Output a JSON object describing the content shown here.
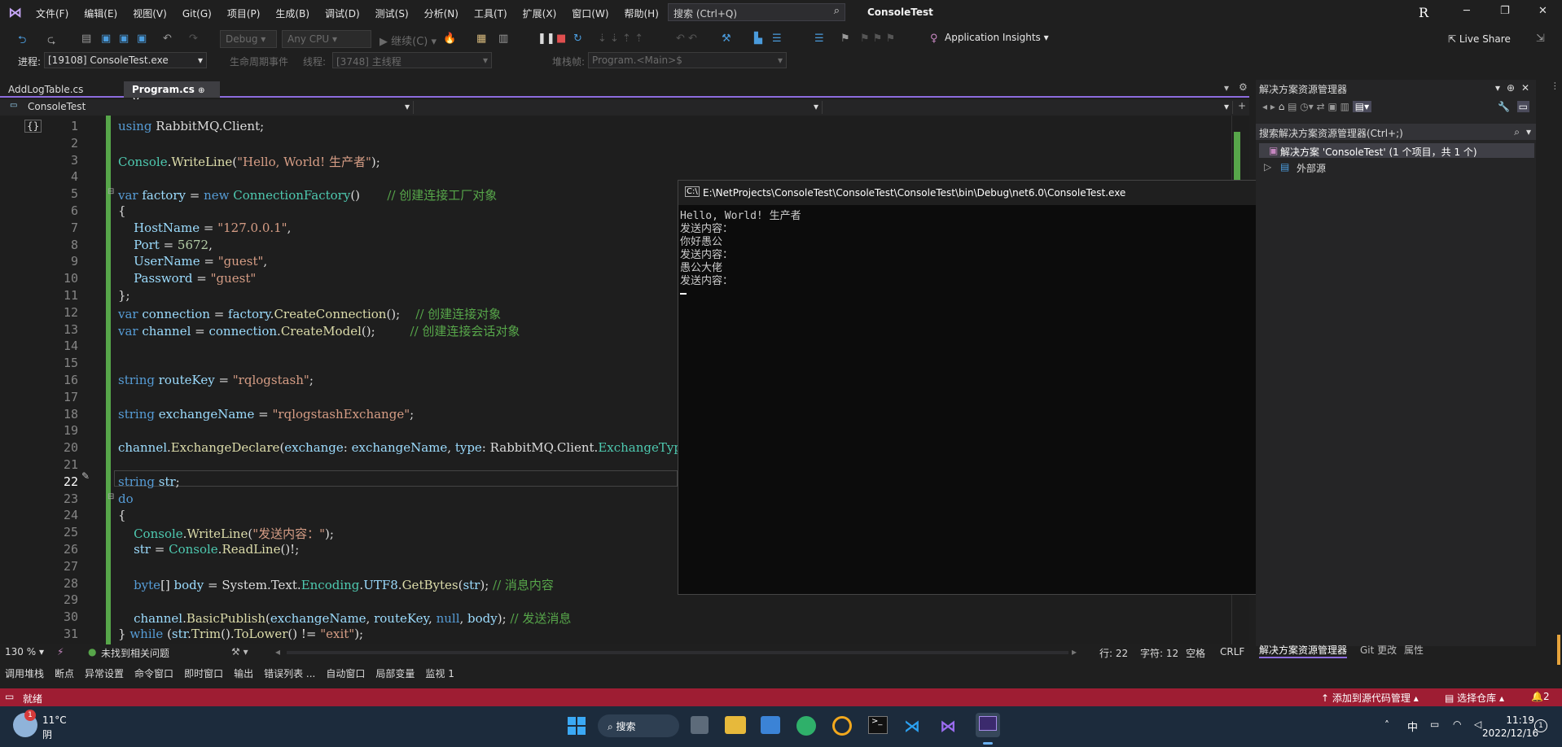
{
  "menubar": {
    "items": [
      "文件(F)",
      "编辑(E)",
      "视图(V)",
      "Git(G)",
      "项目(P)",
      "生成(B)",
      "调试(D)",
      "测试(S)",
      "分析(N)",
      "工具(T)",
      "扩展(X)",
      "窗口(W)",
      "帮助(H)"
    ],
    "search_placeholder": "搜索 (Ctrl+Q)",
    "app_name": "ConsoleTest",
    "avatar": "R"
  },
  "toolbar": {
    "config": "Debug",
    "platform": "Any CPU",
    "continue": "继续(C)",
    "app_insights": "Application Insights",
    "live_share": "Live Share"
  },
  "toolbar2": {
    "process_label": "进程:",
    "process_value": "[19108] ConsoleTest.exe",
    "lifecycle": "生命周期事件",
    "thread_label": "线程:",
    "thread_value": "[3748] 主线程",
    "stack_label": "堆栈帧:",
    "stack_value": "Program.<Main>$"
  },
  "tabs": [
    {
      "label": "AddLogTable.cs",
      "active": false
    },
    {
      "label": "Program.cs",
      "active": true
    }
  ],
  "navbar": {
    "project": "ConsoleTest"
  },
  "editor": {
    "line_numbers": [
      "1",
      "2",
      "3",
      "4",
      "5",
      "6",
      "7",
      "8",
      "9",
      "10",
      "11",
      "12",
      "13",
      "14",
      "15",
      "16",
      "17",
      "18",
      "19",
      "20",
      "21",
      "22",
      "23",
      "24",
      "25",
      "26",
      "27",
      "28",
      "29",
      "30",
      "31"
    ],
    "current_line": "22"
  },
  "console": {
    "title": "E:\\NetProjects\\ConsoleTest\\ConsoleTest\\ConsoleTest\\bin\\Debug\\net6.0\\ConsoleTest.exe",
    "lines": [
      "Hello, World! 生产者",
      "发送内容：",
      "你好愚公",
      "发送内容：",
      "愚公大佬",
      "发送内容："
    ]
  },
  "solution_explorer": {
    "title": "解决方案资源管理器",
    "search": "搜索解决方案资源管理器(Ctrl+;)",
    "solution": "解决方案 'ConsoleTest' (1 个项目，共 1 个)",
    "external": "外部源",
    "bottom_tabs": [
      "解决方案资源管理器",
      "Git 更改",
      "属性"
    ]
  },
  "editor_status": {
    "zoom": "130 %",
    "issues": "未找到相关问题",
    "line": "行: 22",
    "char": "字符: 12",
    "space": "空格",
    "crlf": "CRLF"
  },
  "bottom_tabs": [
    "调用堆栈",
    "断点",
    "异常设置",
    "命令窗口",
    "即时窗口",
    "输出",
    "错误列表 ...",
    "自动窗口",
    "局部变量",
    "监视 1"
  ],
  "statusbar": {
    "ready": "就绪",
    "add_source": "添加到源代码管理",
    "select_repo": "选择仓库",
    "notif": "2"
  },
  "taskbar": {
    "weather_temp": "11°C",
    "weather_desc": "阴",
    "weather_badge": "1",
    "search": "搜索",
    "ime": "中",
    "time": "11:19",
    "date": "2022/12/16",
    "notif": "1"
  },
  "colors": {
    "accent": "#8c6cde",
    "statusbar": "#9e1d33",
    "keyword": "#569cd6",
    "type": "#4ec9b0",
    "string": "#d69d85",
    "comment": "#57a64a"
  }
}
